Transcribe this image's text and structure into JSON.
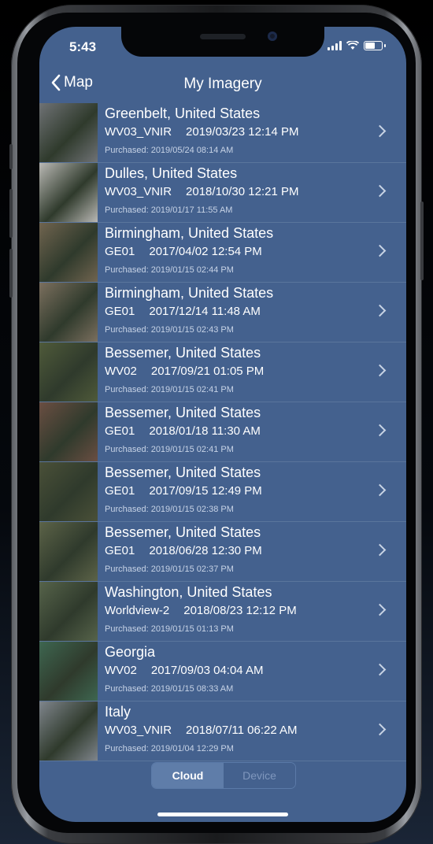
{
  "status_bar": {
    "time": "5:43"
  },
  "nav": {
    "back_label": "Map",
    "title": "My Imagery"
  },
  "items": [
    {
      "title": "Greenbelt, United States",
      "sensor": "WV03_VNIR",
      "captured": "2019/03/23 12:14 PM",
      "purchased": "Purchased: 2019/05/24 08:14 AM",
      "thumb": "#6f7275"
    },
    {
      "title": "Dulles, United States",
      "sensor": "WV03_VNIR",
      "captured": "2018/10/30 12:21 PM",
      "purchased": "Purchased: 2019/01/17 11:55 AM",
      "thumb": "#b9b8b4"
    },
    {
      "title": "Birmingham, United States",
      "sensor": "GE01",
      "captured": "2017/04/02 12:54 PM",
      "purchased": "Purchased: 2019/01/15 02:44 PM",
      "thumb": "#70644f"
    },
    {
      "title": "Birmingham, United States",
      "sensor": "GE01",
      "captured": "2017/12/14 11:48 AM",
      "purchased": "Purchased: 2019/01/15 02:43 PM",
      "thumb": "#7b6f5e"
    },
    {
      "title": "Bessemer, United States",
      "sensor": "WV02",
      "captured": "2017/09/21 01:05 PM",
      "purchased": "Purchased: 2019/01/15 02:41 PM",
      "thumb": "#4f5a3a"
    },
    {
      "title": "Bessemer, United States",
      "sensor": "GE01",
      "captured": "2018/01/18 11:30 AM",
      "purchased": "Purchased: 2019/01/15 02:41 PM",
      "thumb": "#6a4e42"
    },
    {
      "title": "Bessemer, United States",
      "sensor": "GE01",
      "captured": "2017/09/15 12:49 PM",
      "purchased": "Purchased: 2019/01/15 02:38 PM",
      "thumb": "#4a5038"
    },
    {
      "title": "Bessemer, United States",
      "sensor": "GE01",
      "captured": "2018/06/28 12:30 PM",
      "purchased": "Purchased: 2019/01/15 02:37 PM",
      "thumb": "#5c6348"
    },
    {
      "title": "Washington, United States",
      "sensor": "Worldview-2",
      "captured": "2018/08/23 12:12 PM",
      "purchased": "Purchased: 2019/01/15 01:13 PM",
      "thumb": "#56634a"
    },
    {
      "title": "Georgia",
      "sensor": "WV02",
      "captured": "2017/09/03 04:04 AM",
      "purchased": "Purchased: 2019/01/15 08:33 AM",
      "thumb": "#3e6650"
    },
    {
      "title": "Italy",
      "sensor": "WV03_VNIR",
      "captured": "2018/07/11 06:22 AM",
      "purchased": "Purchased: 2019/01/04 12:29 PM",
      "thumb": "#7f858c"
    }
  ],
  "segments": {
    "cloud": "Cloud",
    "device": "Device",
    "selected": "Cloud"
  },
  "colors": {
    "background": "#44618e",
    "separator": "#5a759c",
    "accent_text": "#ffffff",
    "muted_text": "#c7d3e6"
  },
  "icons": {
    "back": "chevron-left-icon",
    "row": "chevron-right-icon",
    "signal": "signal-icon",
    "wifi": "wifi-icon",
    "battery": "battery-icon"
  }
}
